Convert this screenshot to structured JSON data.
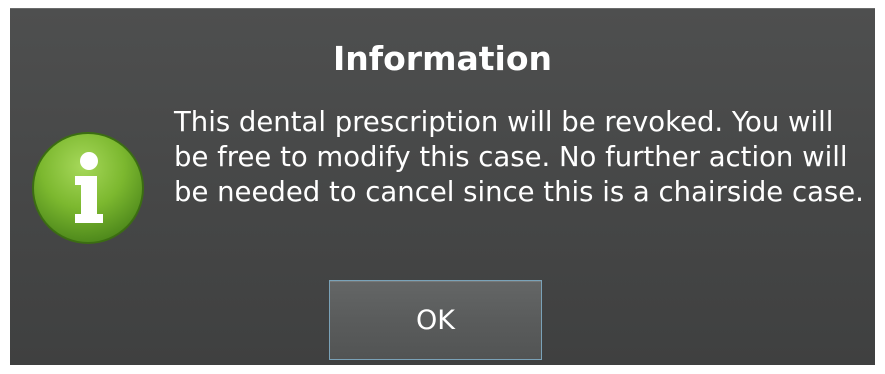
{
  "dialog": {
    "title": "Information",
    "icon": "info-icon",
    "message": "This dental prescription will be revoked. You will be free to modify this case. No further action will be needed to cancel since this is a chairside case.",
    "ok_label": "OK"
  },
  "colors": {
    "dialog_background": "#474848",
    "text": "#ffffff",
    "icon_green": "#7cb82f",
    "button_border": "#7aa2b8"
  }
}
